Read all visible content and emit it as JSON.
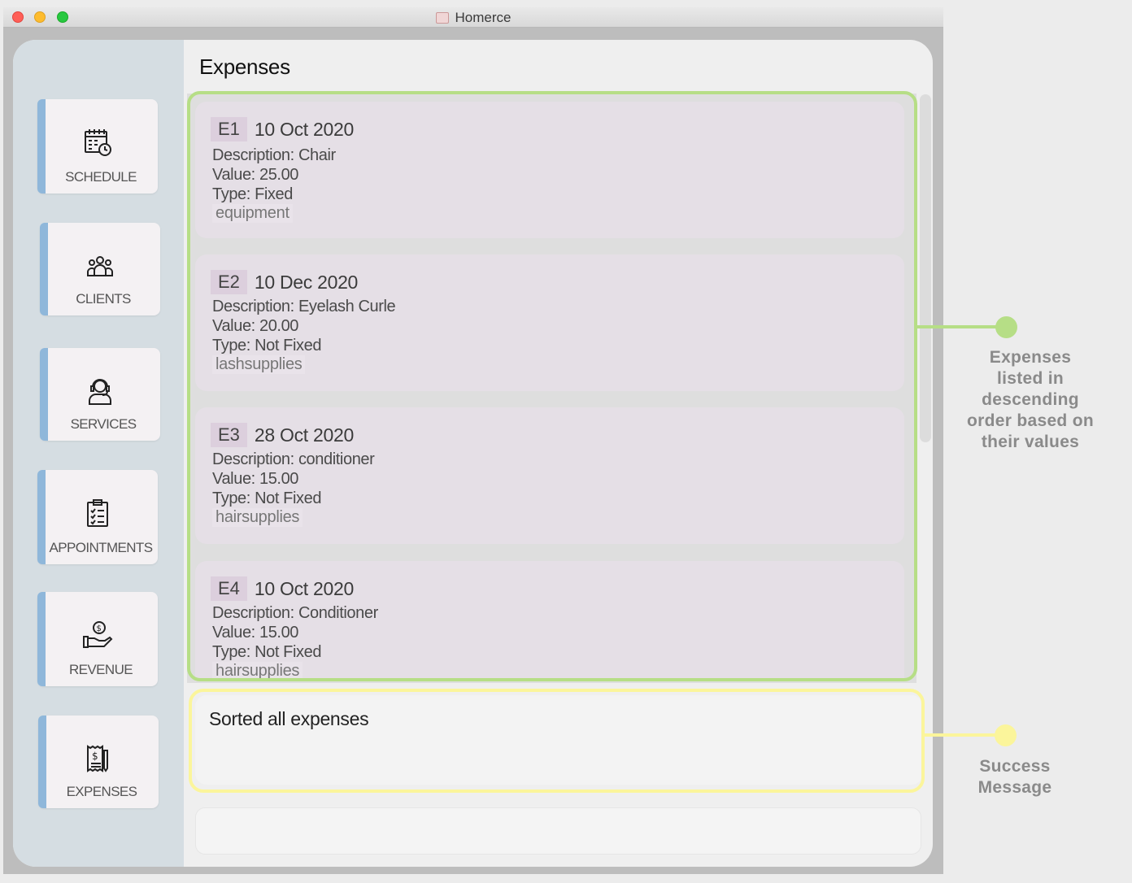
{
  "window": {
    "title": "Homerce"
  },
  "header": {
    "title": "Expenses"
  },
  "sidebar": {
    "items": [
      {
        "label": "SCHEDULE",
        "icon": "calendar-clock-icon"
      },
      {
        "label": "CLIENTS",
        "icon": "group-icon"
      },
      {
        "label": "SERVICES",
        "icon": "headset-person-icon"
      },
      {
        "label": "APPOINTMENTS",
        "icon": "clipboard-checklist-icon"
      },
      {
        "label": "REVENUE",
        "icon": "hand-dollar-icon"
      },
      {
        "label": "EXPENSES",
        "icon": "receipt-dollar-icon"
      }
    ]
  },
  "expenses": [
    {
      "id": "E1",
      "date": "10 Oct 2020",
      "description": "Description: Chair",
      "value": "Value: 25.00",
      "type": "Type: Fixed",
      "tag": "equipment"
    },
    {
      "id": "E2",
      "date": "10 Dec 2020",
      "description": "Description: Eyelash Curle",
      "value": "Value: 20.00",
      "type": "Type: Not Fixed",
      "tag": "lashsupplies"
    },
    {
      "id": "E3",
      "date": "28 Oct 2020",
      "description": "Description: conditioner",
      "value": "Value: 15.00",
      "type": "Type: Not Fixed",
      "tag": "hairsupplies"
    },
    {
      "id": "E4",
      "date": "10 Oct 2020",
      "description": "Description: Conditioner",
      "value": "Value: 15.00",
      "type": "Type: Not Fixed",
      "tag": "hairsupplies"
    }
  ],
  "result": {
    "message": "Sorted all expenses"
  },
  "command": {
    "value": ""
  },
  "annotations": {
    "list_note": [
      "Expenses",
      "listed in",
      "descending",
      "order based on",
      "their values"
    ],
    "result_note": [
      "Success",
      "Message"
    ],
    "list_color": "#b6de86",
    "result_color": "#fbf59b"
  }
}
